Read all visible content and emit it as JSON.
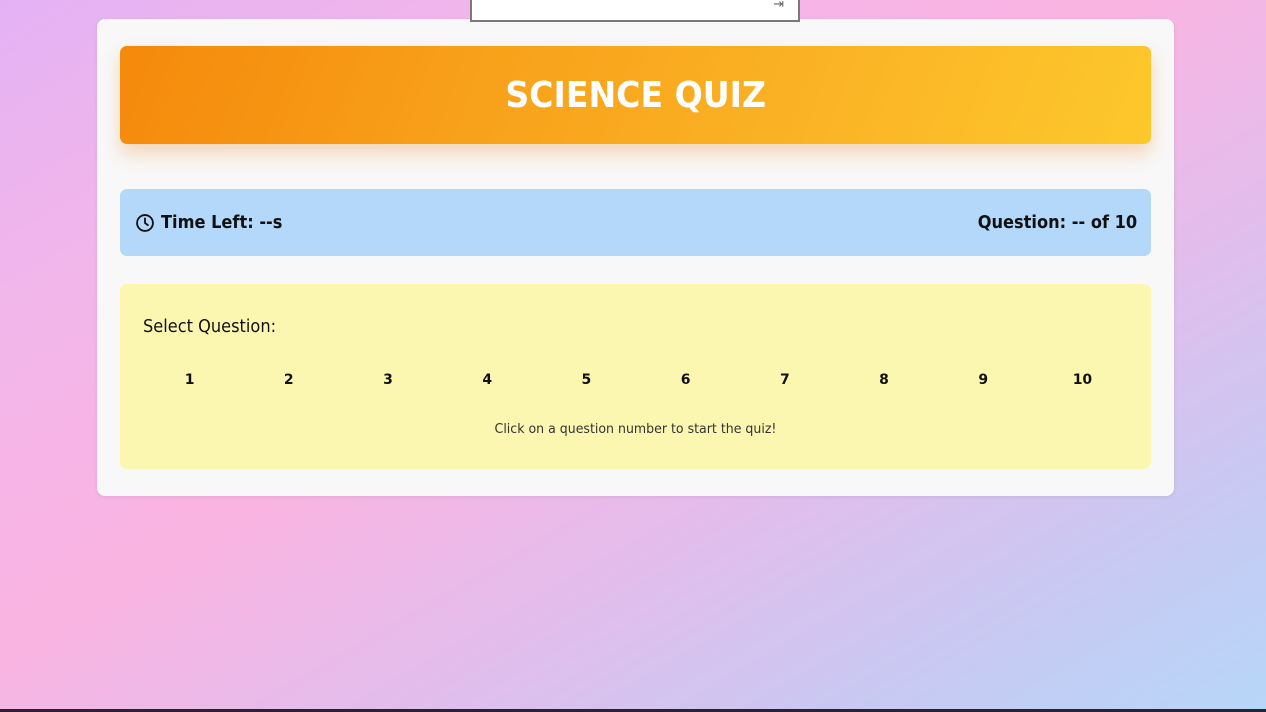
{
  "header": {
    "title": "SCIENCE QUIZ"
  },
  "status": {
    "time_left": "Time Left: --s",
    "question_counter": "Question: -- of 10",
    "clock_icon": "clock-icon"
  },
  "selector": {
    "title": "Select Question:",
    "numbers": [
      "1",
      "2",
      "3",
      "4",
      "5",
      "6",
      "7",
      "8",
      "9",
      "10"
    ],
    "hint": "Click on a question number to start the quiz!"
  },
  "popup": {
    "icon": "pin-icon"
  },
  "colors": {
    "header_gradient_start": "#f5890b",
    "header_gradient_end": "#fdc82c",
    "status_bg": "#b3d8fa",
    "selector_bg": "#fcf7b0",
    "card_bg": "#f8f8f8"
  }
}
